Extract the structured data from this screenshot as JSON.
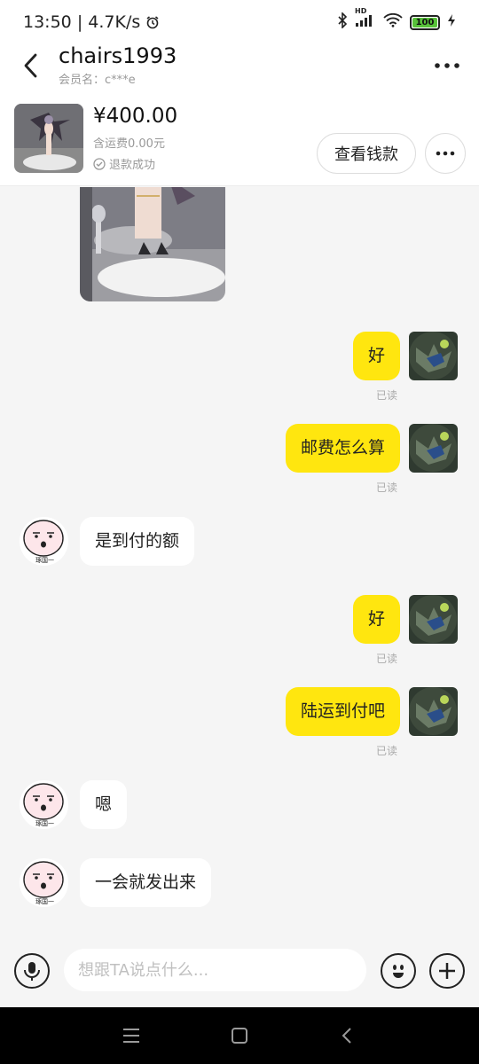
{
  "status_bar": {
    "time": "13:50",
    "network_speed": "4.7K/s",
    "battery": "100",
    "hd_label": "HD"
  },
  "header": {
    "title": "chairs1993",
    "subtitle": "会员名：c***e"
  },
  "product": {
    "price": "¥400.00",
    "shipping": "含运费0.00元",
    "status": "退款成功",
    "view_button": "查看钱款"
  },
  "messages": [
    {
      "sender": "me",
      "text": "好",
      "read": "已读"
    },
    {
      "sender": "me",
      "text": "邮费怎么算",
      "read": "已读"
    },
    {
      "sender": "other",
      "text": "是到付的额"
    },
    {
      "sender": "me",
      "text": "好",
      "read": "已读"
    },
    {
      "sender": "me",
      "text": "陆运到付吧",
      "read": "已读"
    },
    {
      "sender": "other",
      "text": "嗯"
    },
    {
      "sender": "other",
      "text": "一会就发出来"
    }
  ],
  "contact_avatar_caption": "琢国一",
  "input": {
    "placeholder": "想跟TA说点什么..."
  },
  "colors": {
    "my_bubble": "#ffe60f",
    "their_bubble": "#ffffff",
    "background": "#f5f5f5",
    "battery": "#58c23a"
  }
}
